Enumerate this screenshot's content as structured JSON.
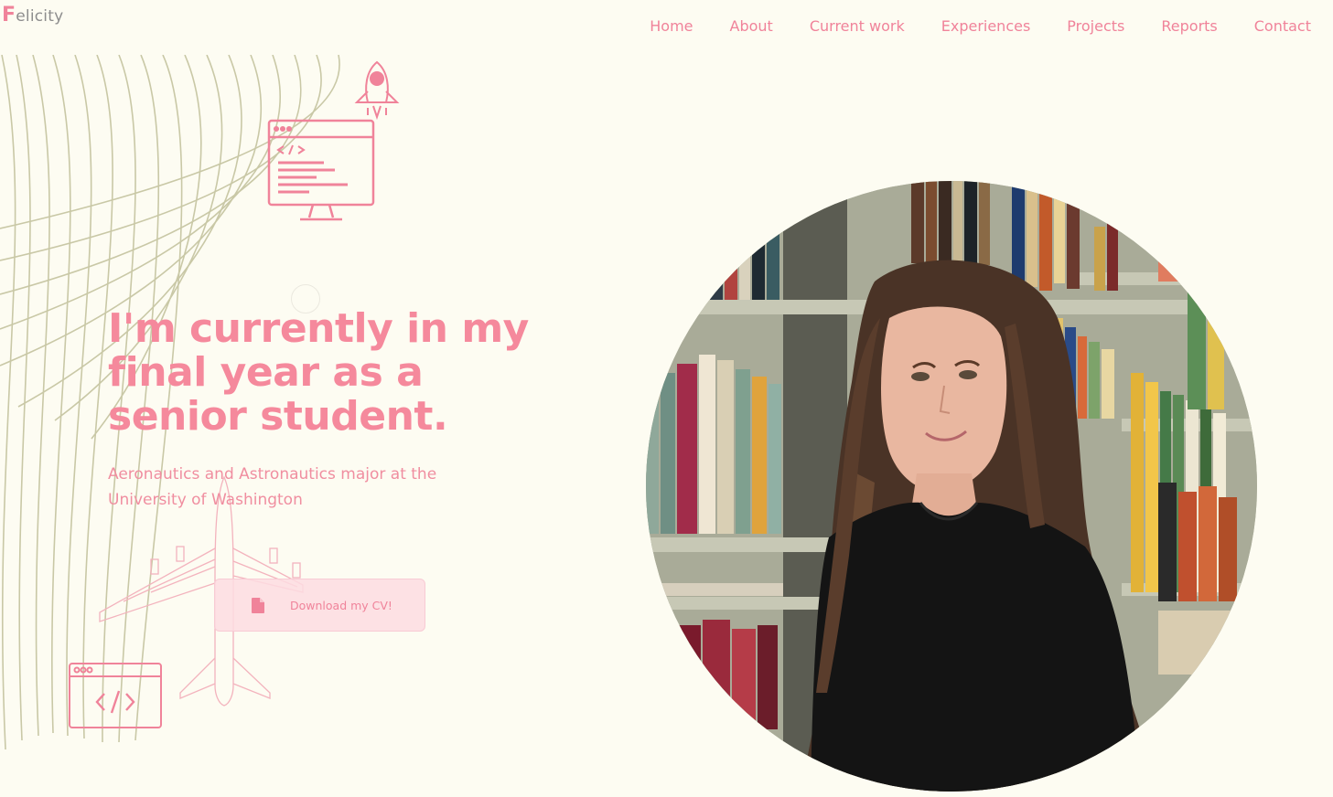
{
  "brand": {
    "initial": "F",
    "rest": "elicity"
  },
  "nav": {
    "items": [
      "Home",
      "About",
      "Current work",
      "Experiences",
      "Projects",
      "Reports",
      "Contact"
    ]
  },
  "hero": {
    "line1": "I'm currently in my",
    "line2": "final year as a",
    "line3_bold": "senior student",
    "line3_tail": ".",
    "subtitle": "Aeronautics and Astronautics major at the University of Washington",
    "cv_button": "Download my CV!"
  },
  "icons": {
    "rocket": "rocket-icon",
    "monitor": "code-monitor-icon",
    "airplane": "airplane-blueprint-icon",
    "code_window": "code-window-icon",
    "cv": "file-icon"
  },
  "colors": {
    "background": "#fdfcf2",
    "accent": "#f0839a",
    "waves": "#c9c8a6",
    "brand_grey": "#8d8d8d"
  }
}
